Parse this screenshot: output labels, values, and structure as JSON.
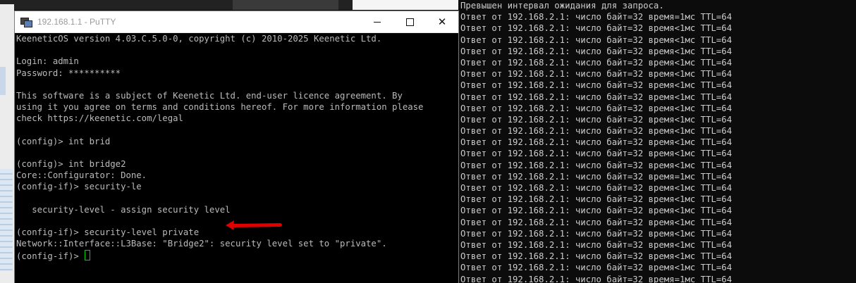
{
  "colors": {
    "terminal_bg": "#000000",
    "terminal_text": "#bbbbbb",
    "cursor": "#00d000",
    "annotation_arrow": "#e10000",
    "cmd_text": "#cccccc"
  },
  "putty": {
    "title": "192.168.1.1 - PuTTY",
    "icon": "putty-icon",
    "controls": [
      "minimize-icon",
      "maximize-icon",
      "close-icon"
    ],
    "close_glyph": "✕",
    "lines": [
      "KeeneticOS version 4.03.C.5.0-0, copyright (c) 2010-2025 Keenetic Ltd.",
      "",
      "Login: admin",
      "Password: **********",
      "",
      "This software is a subject of Keenetic Ltd. end-user licence agreement. By",
      "using it you agree on terms and conditions hereof. For more information please",
      "check https://keenetic.com/legal",
      "",
      "(config)> int brid",
      "",
      "(config)> int bridge2",
      "Core::Configurator: Done.",
      "(config-if)> security-le",
      "",
      "   security-level - assign security level",
      "",
      "(config-if)> security-level private",
      "Network::Interface::L3Base: \"Bridge2\": security level set to \"private\".",
      "(config-if)> "
    ]
  },
  "cmd": {
    "lines": [
      "Превышен интервал ожидания для запроса.",
      "Ответ от 192.168.2.1: число байт=32 время=1мс TTL=64",
      "Ответ от 192.168.2.1: число байт=32 время<1мс TTL=64",
      "Ответ от 192.168.2.1: число байт=32 время<1мс TTL=64",
      "Ответ от 192.168.2.1: число байт=32 время<1мс TTL=64",
      "Ответ от 192.168.2.1: число байт=32 время<1мс TTL=64",
      "Ответ от 192.168.2.1: число байт=32 время<1мс TTL=64",
      "Ответ от 192.168.2.1: число байт=32 время<1мс TTL=64",
      "Ответ от 192.168.2.1: число байт=32 время<1мс TTL=64",
      "Ответ от 192.168.2.1: число байт=32 время<1мс TTL=64",
      "Ответ от 192.168.2.1: число байт=32 время<1мс TTL=64",
      "Ответ от 192.168.2.1: число байт=32 время<1мс TTL=64",
      "Ответ от 192.168.2.1: число байт=32 время<1мс TTL=64",
      "Ответ от 192.168.2.1: число байт=32 время<1мс TTL=64",
      "Ответ от 192.168.2.1: число байт=32 время<1мс TTL=64",
      "Ответ от 192.168.2.1: число байт=32 время=1мс TTL=64",
      "Ответ от 192.168.2.1: число байт=32 время<1мс TTL=64",
      "Ответ от 192.168.2.1: число байт=32 время<1мс TTL=64",
      "Ответ от 192.168.2.1: число байт=32 время<1мс TTL=64",
      "Ответ от 192.168.2.1: число байт=32 время<1мс TTL=64",
      "Ответ от 192.168.2.1: число байт=32 время<1мс TTL=64",
      "Ответ от 192.168.2.1: число байт=32 время<1мс TTL=64",
      "Ответ от 192.168.2.1: число байт=32 время<1мс TTL=64",
      "Ответ от 192.168.2.1: число байт=32 время<1мс TTL=64",
      "Ответ от 192.168.2.1: число байт=32 время=1мс TTL=64"
    ]
  }
}
